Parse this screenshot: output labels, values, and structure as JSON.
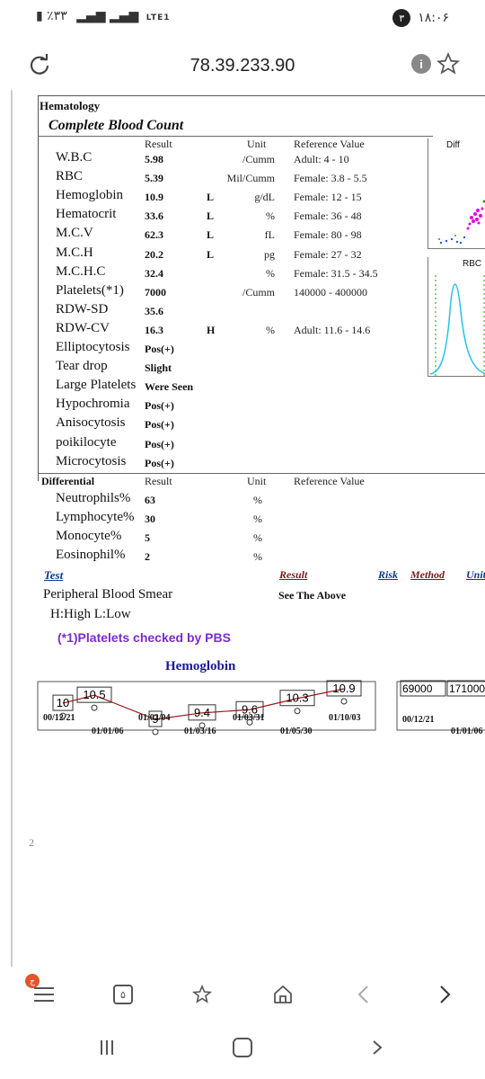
{
  "status": {
    "left": "٪۳۳",
    "network": "LTE1",
    "time": "۱۸:۰۶",
    "notif": "۳"
  },
  "browser": {
    "url": "78.39.233.90"
  },
  "report": {
    "section": "Hematology",
    "subtitle": "Complete Blood Count",
    "headers": {
      "result": "Result",
      "unit": "Unit",
      "ref": "Reference Value"
    },
    "cbc": [
      {
        "name": "W.B.C",
        "value": "5.98",
        "flag": "",
        "unit": "/Cumm",
        "ref": "Adult: 4 - 10"
      },
      {
        "name": "RBC",
        "value": "5.39",
        "flag": "",
        "unit": "Mil/Cumm",
        "ref": "Female: 3.8 - 5.5"
      },
      {
        "name": "Hemoglobin",
        "value": "10.9",
        "flag": "L",
        "unit": "g/dL",
        "ref": "Female: 12 - 15"
      },
      {
        "name": "Hematocrit",
        "value": "33.6",
        "flag": "L",
        "unit": "%",
        "ref": "Female: 36 - 48"
      },
      {
        "name": "M.C.V",
        "value": "62.3",
        "flag": "L",
        "unit": "fL",
        "ref": "Female: 80 - 98"
      },
      {
        "name": "M.C.H",
        "value": "20.2",
        "flag": "L",
        "unit": "pg",
        "ref": "Female: 27 - 32"
      },
      {
        "name": "M.C.H.C",
        "value": "32.4",
        "flag": "",
        "unit": "%",
        "ref": "Female: 31.5 - 34.5"
      },
      {
        "name": "Platelets(*1)",
        "value": "7000",
        "flag": "",
        "unit": "/Cumm",
        "ref": "140000 - 400000"
      },
      {
        "name": "RDW-SD",
        "value": "35.6",
        "flag": "",
        "unit": "",
        "ref": ""
      },
      {
        "name": "RDW-CV",
        "value": "16.3",
        "flag": "H",
        "unit": "%",
        "ref": "Adult: 11.6 - 14.6"
      },
      {
        "name": "Elliptocytosis",
        "value": "Pos(+)",
        "flag": "",
        "unit": "",
        "ref": ""
      },
      {
        "name": "Tear drop",
        "value": "Slight",
        "flag": "",
        "unit": "",
        "ref": ""
      },
      {
        "name": "Large Platelets",
        "value": "Were Seen",
        "flag": "",
        "unit": "",
        "ref": ""
      },
      {
        "name": "Hypochromia",
        "value": "Pos(+)",
        "flag": "",
        "unit": "",
        "ref": ""
      },
      {
        "name": "Anisocytosis",
        "value": "Pos(+)",
        "flag": "",
        "unit": "",
        "ref": ""
      },
      {
        "name": "poikilocyte",
        "value": "Pos(+)",
        "flag": "",
        "unit": "",
        "ref": ""
      },
      {
        "name": "Microcytosis",
        "value": "Pos(+)",
        "flag": "",
        "unit": "",
        "ref": ""
      }
    ],
    "differential": {
      "title": "Differential",
      "rows": [
        {
          "name": "Neutrophils%",
          "value": "63",
          "unit": "%"
        },
        {
          "name": "Lymphocyte%",
          "value": "30",
          "unit": "%"
        },
        {
          "name": "Monocyte%",
          "value": "5",
          "unit": "%"
        },
        {
          "name": "Eosinophil%",
          "value": "2",
          "unit": "%"
        }
      ]
    },
    "links": {
      "test": "Test",
      "result": "Result",
      "risk": "Risk",
      "method": "Method",
      "unit": "Unit"
    },
    "smear": {
      "label": "Peripheral Blood Smear",
      "value": "See The Above"
    },
    "legend": "H:High L:Low",
    "note": "(*1)Platelets checked by PBS",
    "scatter_title": "Diff",
    "rbc_title": "RBC",
    "page_number": "2"
  },
  "trend": {
    "title": "Hemoglobin",
    "values": [
      "10",
      "10.5",
      "9",
      "9.4",
      "9.6",
      "10.3",
      "10.9"
    ],
    "dates_top": [
      "00/12/21",
      "01/02/04",
      "01/03/31",
      "01/10/03"
    ],
    "dates_bottom": [
      "01/01/06",
      "01/03/16",
      "01/05/30"
    ],
    "plt_values": [
      "69000",
      "171000"
    ],
    "plt_dates_top": [
      "00/12/21"
    ],
    "plt_dates_bottom": [
      "01/01/06"
    ]
  },
  "chart_data": {
    "type": "line",
    "title": "Hemoglobin",
    "x": [
      "00/12/21",
      "01/01/06",
      "01/02/04",
      "01/03/16",
      "01/03/31",
      "01/05/30",
      "01/10/03"
    ],
    "series": [
      {
        "values": [
          10,
          10.5,
          9,
          9.4,
          9.6,
          10.3,
          10.9
        ]
      }
    ]
  },
  "toolbar": {
    "tabs_count": "۵",
    "menu_badge": "ج"
  }
}
